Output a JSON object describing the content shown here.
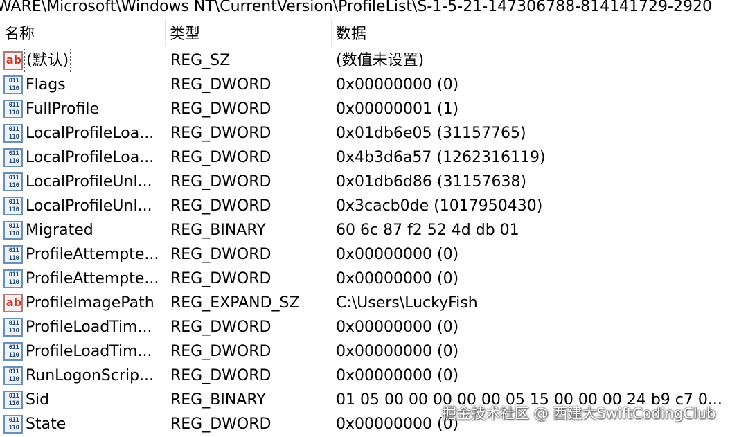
{
  "path": "WARE\\Microsoft\\Windows NT\\CurrentVersion\\ProfileList\\S-1-5-21-147306788-814141729-2920",
  "columns": {
    "name": "名称",
    "type": "类型",
    "data": "数据"
  },
  "rows": [
    {
      "icon": "string-value-icon",
      "name": "(默认)",
      "type": "REG_SZ",
      "data": "(数值未设置)"
    },
    {
      "icon": "binary-value-icon",
      "name": "Flags",
      "type": "REG_DWORD",
      "data": "0x00000000 (0)"
    },
    {
      "icon": "binary-value-icon",
      "name": "FullProfile",
      "type": "REG_DWORD",
      "data": "0x00000001 (1)"
    },
    {
      "icon": "binary-value-icon",
      "name": "LocalProfileLoa...",
      "type": "REG_DWORD",
      "data": "0x01db6e05 (31157765)"
    },
    {
      "icon": "binary-value-icon",
      "name": "LocalProfileLoa...",
      "type": "REG_DWORD",
      "data": "0x4b3d6a57 (1262316119)"
    },
    {
      "icon": "binary-value-icon",
      "name": "LocalProfileUnl...",
      "type": "REG_DWORD",
      "data": "0x01db6d86 (31157638)"
    },
    {
      "icon": "binary-value-icon",
      "name": "LocalProfileUnl...",
      "type": "REG_DWORD",
      "data": "0x3cacb0de (1017950430)"
    },
    {
      "icon": "binary-value-icon",
      "name": "Migrated",
      "type": "REG_BINARY",
      "data": "60 6c 87 f2 52 4d db 01"
    },
    {
      "icon": "binary-value-icon",
      "name": "ProfileAttempte...",
      "type": "REG_DWORD",
      "data": "0x00000000 (0)"
    },
    {
      "icon": "binary-value-icon",
      "name": "ProfileAttempte...",
      "type": "REG_DWORD",
      "data": "0x00000000 (0)"
    },
    {
      "icon": "string-value-icon",
      "name": "ProfileImagePath",
      "type": "REG_EXPAND_SZ",
      "data": "C:\\Users\\LuckyFish"
    },
    {
      "icon": "binary-value-icon",
      "name": "ProfileLoadTim...",
      "type": "REG_DWORD",
      "data": "0x00000000 (0)"
    },
    {
      "icon": "binary-value-icon",
      "name": "ProfileLoadTim...",
      "type": "REG_DWORD",
      "data": "0x00000000 (0)"
    },
    {
      "icon": "binary-value-icon",
      "name": "RunLogonScrip...",
      "type": "REG_DWORD",
      "data": "0x00000000 (0)"
    },
    {
      "icon": "binary-value-icon",
      "name": "Sid",
      "type": "REG_BINARY",
      "data": "01 05 00 00 00 00 00 05 15 00 00 00 24 b9 c7 0..."
    },
    {
      "icon": "binary-value-icon",
      "name": "State",
      "type": "REG_DWORD",
      "data": "0x00000000 (0)"
    }
  ],
  "watermark": "掘金技术社区 @ 西建大SwiftCodingClub"
}
